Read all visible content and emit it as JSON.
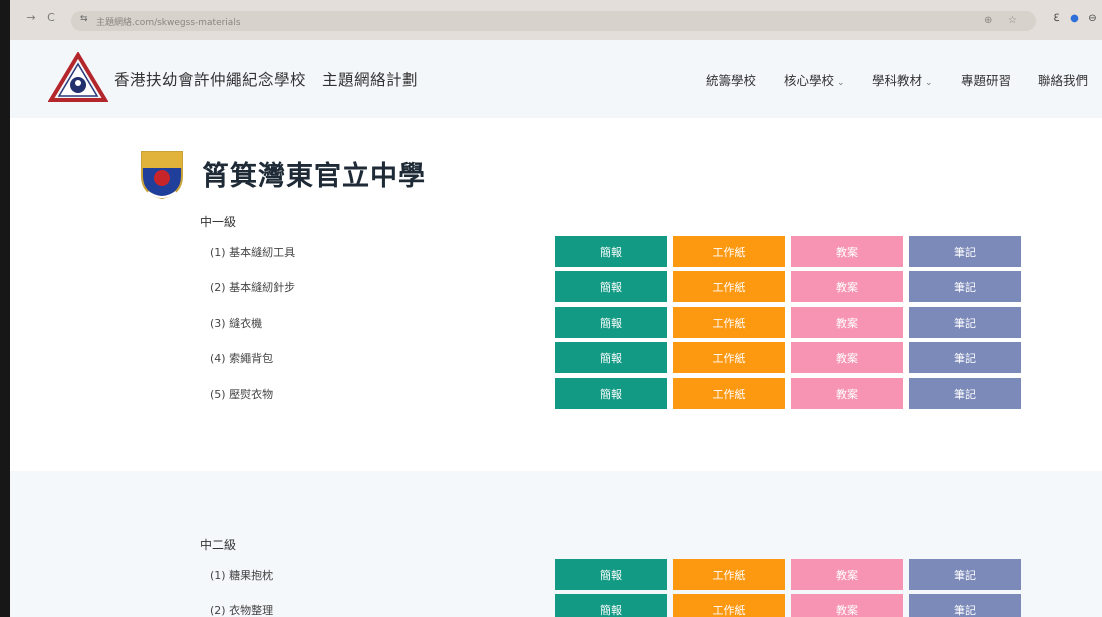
{
  "browser": {
    "back_icon": "arrow-right-icon",
    "reload_icon": "reload-icon",
    "url": "主題網絡.com/skwegss-materials"
  },
  "site": {
    "title": "香港扶幼會許仲繩紀念學校　主題網絡計劃",
    "nav": [
      {
        "label": "統籌學校"
      },
      {
        "label": "核心學校",
        "caret": "⌄"
      },
      {
        "label": "學科教材",
        "caret": "⌄"
      },
      {
        "label": "專題研習"
      },
      {
        "label": "聯絡我們"
      }
    ]
  },
  "school": {
    "name": "筲箕灣東官立中學"
  },
  "button_labels": [
    "簡報",
    "工作紙",
    "教案",
    "筆記"
  ],
  "levels": [
    {
      "name": "中一級",
      "items": [
        "(1) 基本縫紉工具",
        "(2) 基本縫紉針步",
        "(3) 縫衣機",
        "(4) 索繩背包",
        "(5) 壓熨衣物"
      ]
    },
    {
      "name": "中二級",
      "items": [
        "(1) 糖果抱枕",
        "(2) 衣物整理"
      ]
    }
  ],
  "colors": {
    "slides": "#129a84",
    "worksheet": "#fd9811",
    "lesson_plan": "#f794b3",
    "notes": "#7b8ab9"
  }
}
